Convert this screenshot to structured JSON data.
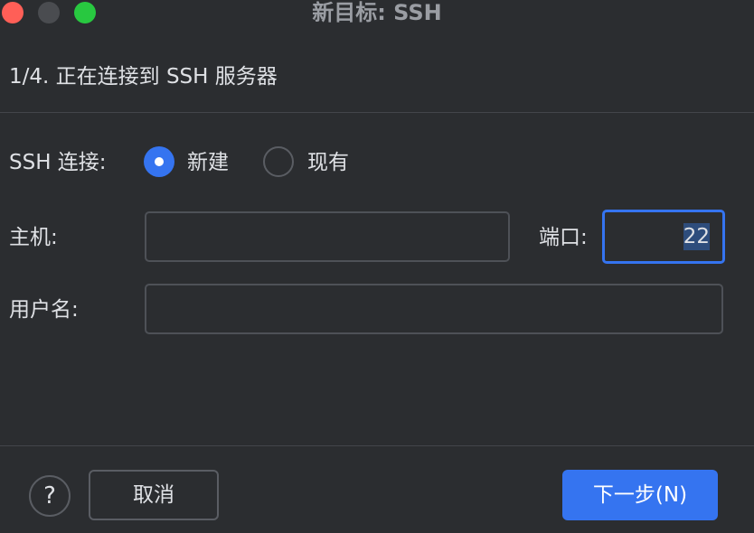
{
  "window": {
    "title": "新目标: SSH"
  },
  "step": {
    "title": "1/4. 正在连接到 SSH 服务器"
  },
  "ssh_connection": {
    "label": "SSH 连接:",
    "options": [
      {
        "label": "新建",
        "selected": true
      },
      {
        "label": "现有",
        "selected": false
      }
    ]
  },
  "host": {
    "label": "主机:",
    "value": ""
  },
  "port": {
    "label": "端口:",
    "value": "22"
  },
  "username": {
    "label": "用户名:",
    "value": ""
  },
  "footer": {
    "help_label": "?",
    "cancel_label": "取消",
    "next_label": "下一步(N)"
  },
  "colors": {
    "background": "#2b2d30",
    "accent": "#3574f0",
    "close": "#ff5f57",
    "maximize": "#28c840"
  }
}
